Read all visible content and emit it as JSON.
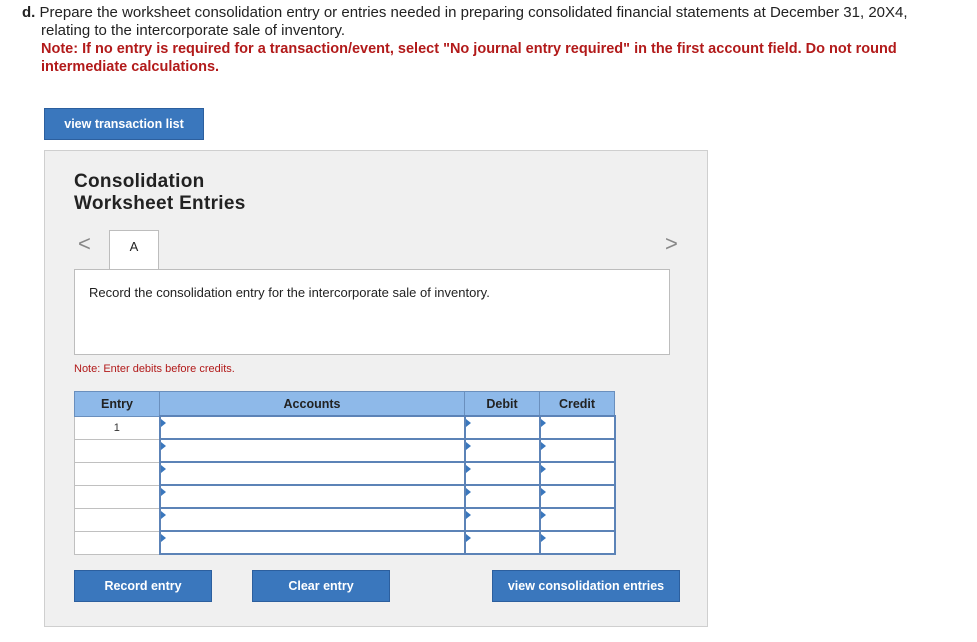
{
  "question": {
    "letter": "d.",
    "line1": "Prepare the worksheet consolidation entry or entries needed in preparing consolidated financial statements at December 31, 20X4,",
    "line2": "relating to the intercorporate sale of inventory.",
    "note1": "Note: If no entry is required for a transaction/event, select \"No journal entry required\" in the first account field. Do not round",
    "note2": "intermediate calculations."
  },
  "buttons": {
    "view_transactions": "view transaction list",
    "record": "Record entry",
    "clear": "Clear entry",
    "view_consolidation": "view consolidation entries"
  },
  "panel": {
    "title_line1": "Consolidation",
    "title_line2": "Worksheet Entries",
    "tab_label": "A",
    "prev_icon": "<",
    "next_icon": ">",
    "instruction": "Record the consolidation entry for the intercorporate sale of inventory.",
    "enter_note": "Note: Enter debits before credits."
  },
  "table": {
    "headers": {
      "entry": "Entry",
      "accounts": "Accounts",
      "debit": "Debit",
      "credit": "Credit"
    },
    "rows": [
      {
        "entry": "1",
        "account": "",
        "debit": "",
        "credit": ""
      },
      {
        "entry": "",
        "account": "",
        "debit": "",
        "credit": ""
      },
      {
        "entry": "",
        "account": "",
        "debit": "",
        "credit": ""
      },
      {
        "entry": "",
        "account": "",
        "debit": "",
        "credit": ""
      },
      {
        "entry": "",
        "account": "",
        "debit": "",
        "credit": ""
      },
      {
        "entry": "",
        "account": "",
        "debit": "",
        "credit": ""
      }
    ]
  },
  "colors": {
    "accent": "#3a77bd",
    "header": "#8eb9e9",
    "note": "#b21a1a"
  }
}
